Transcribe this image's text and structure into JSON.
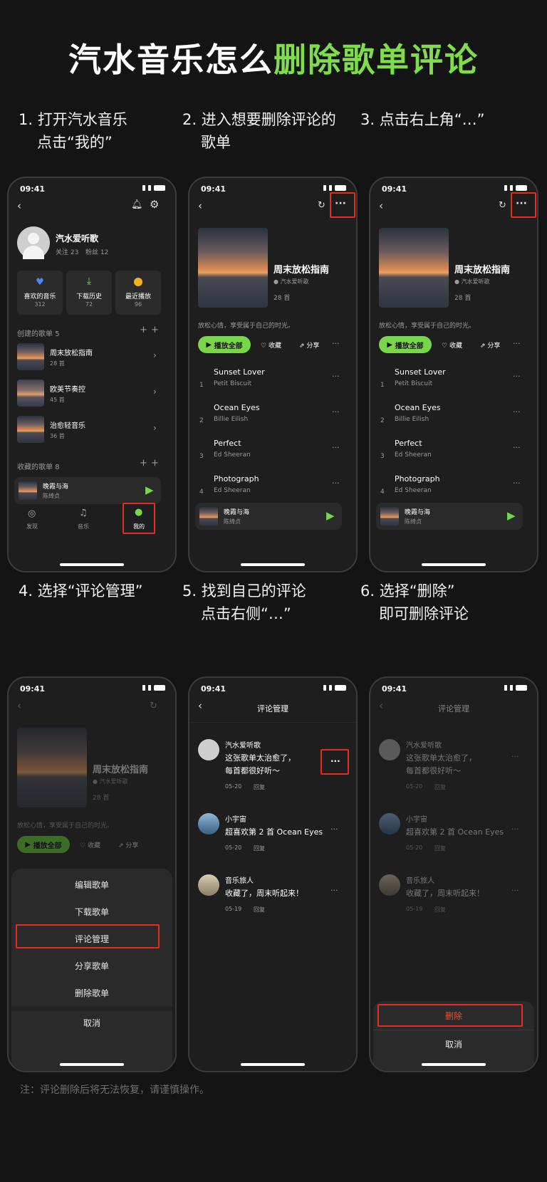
{
  "title": {
    "part1": "汽水音乐怎么",
    "part2": "删除歌单评论"
  },
  "steps": [
    {
      "line1": "1. 打开汽水音乐",
      "line2": "点击“我的”"
    },
    {
      "line1": "2. 进入想要删除评论的",
      "line2": "歌单"
    },
    {
      "line1": "3. 点击右上角“…”",
      "line2": ""
    },
    {
      "line1": "4. 选择“评论管理”",
      "line2": ""
    },
    {
      "line1": "5. 找到自己的评论",
      "line2": "点击右侧“…”"
    },
    {
      "line1": "6. 选择“删除”",
      "line2": "即可删除评论"
    }
  ],
  "status": {
    "time": "09:41"
  },
  "profile": {
    "name": "汽水爱听歌",
    "follow": "关注 23",
    "fans": "粉丝 12",
    "cards": [
      {
        "label": "喜欢的音乐",
        "count": "312",
        "color": "#4f86f7"
      },
      {
        "label": "下载历史",
        "count": "72",
        "color": "#79d64a"
      },
      {
        "label": "最近播放",
        "count": "96",
        "color": "#f0b31c"
      }
    ],
    "created_label": "创建的歌单",
    "created_count": "5",
    "playlists": [
      {
        "name": "周末放松指南",
        "count": "28 首"
      },
      {
        "name": "欧美节奏控",
        "count": "45 首"
      },
      {
        "name": "治愈轻音乐",
        "count": "36 首"
      }
    ],
    "collected_label": "收藏的歌单",
    "collected_count": "8",
    "tabs": [
      {
        "label": "发现"
      },
      {
        "label": "音乐"
      },
      {
        "label": "我的"
      }
    ]
  },
  "mini_player": {
    "song": "晚霞与海",
    "artist": "陈绮贞"
  },
  "playlist": {
    "name": "周末放松指南",
    "owner": "汽水爱听歌",
    "count": "28 首",
    "desc": "放松心情，享受属于自己的时光。",
    "play_all": "播放全部",
    "collect": "收藏",
    "share": "分享",
    "songs": [
      {
        "no": "1",
        "title": "Sunset Lover",
        "artist": "Petit Biscuit"
      },
      {
        "no": "2",
        "title": "Ocean Eyes",
        "artist": "Billie Eilish"
      },
      {
        "no": "3",
        "title": "Perfect",
        "artist": "Ed Sheeran"
      },
      {
        "no": "4",
        "title": "Photograph",
        "artist": "Ed Sheeran"
      }
    ]
  },
  "menu": {
    "items": [
      "编辑歌单",
      "下载歌单",
      "评论管理",
      "分享歌单",
      "删除歌单"
    ],
    "cancel": "取消"
  },
  "comments": {
    "header": "评论管理",
    "list": [
      {
        "user": "汽水爱听歌",
        "line1": "这张歌单太治愈了，",
        "line2": "每首都很好听～",
        "date": "05-20",
        "reply": "回复"
      },
      {
        "user": "小宇宙",
        "line1": "超喜欢第 2 首 Ocean Eyes",
        "line2": "",
        "date": "05-20",
        "reply": "回复"
      },
      {
        "user": "音乐旅人",
        "line1": "收藏了，周末听起来！",
        "line2": "",
        "date": "05-19",
        "reply": "回复"
      }
    ],
    "delete": "删除",
    "cancel": "取消"
  },
  "note": "注：评论删除后将无法恢复，请谨慎操作。",
  "colors": {
    "accent": "#7fdc4a",
    "highlight": "#e32b1f",
    "delete": "#e5553d"
  }
}
